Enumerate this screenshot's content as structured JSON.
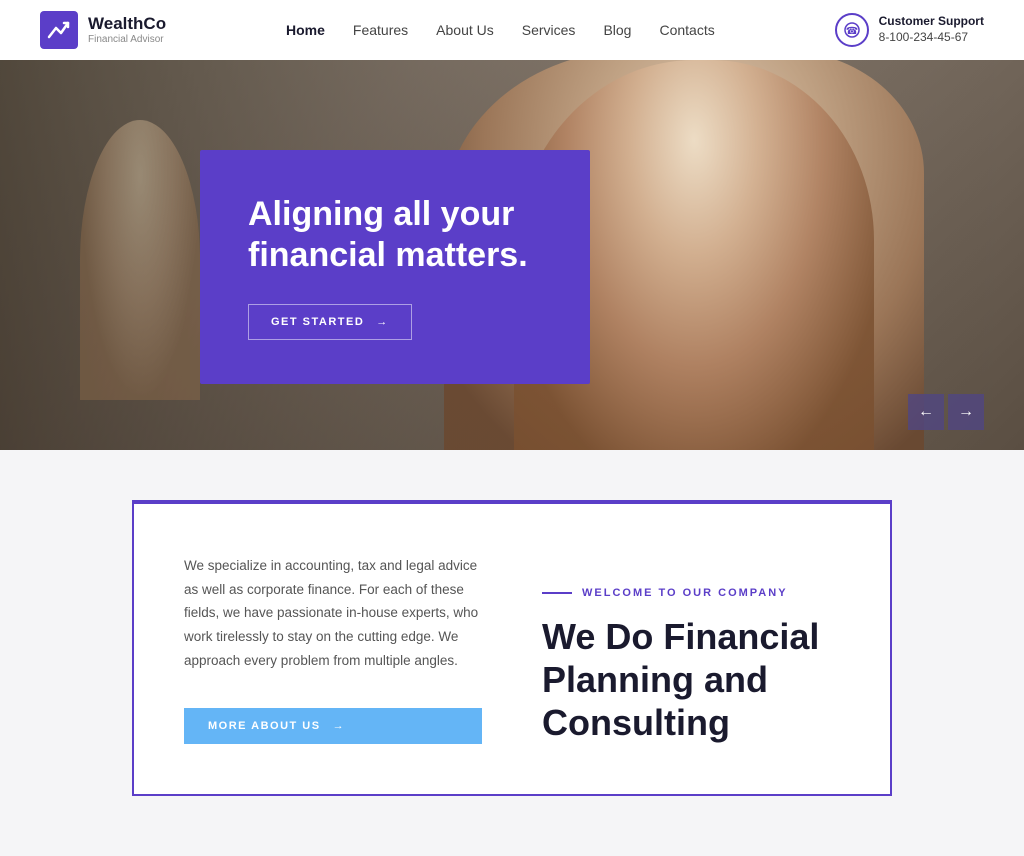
{
  "brand": {
    "name": "WealthCo",
    "subtitle": "Financial Advisor",
    "logo_icon": "chart-icon"
  },
  "nav": {
    "items": [
      {
        "label": "Home",
        "active": true
      },
      {
        "label": "Features",
        "active": false
      },
      {
        "label": "About Us",
        "active": false
      },
      {
        "label": "Services",
        "active": false
      },
      {
        "label": "Blog",
        "active": false
      },
      {
        "label": "Contacts",
        "active": false
      }
    ]
  },
  "support": {
    "label": "Customer Support",
    "phone": "8-100-234-45-67"
  },
  "hero": {
    "title": "Aligning all your financial matters.",
    "cta_label": "GET STARTED",
    "arrow_left": "←",
    "arrow_right": "→"
  },
  "about": {
    "welcome_label": "WELCOME TO OUR COMPANY",
    "description": "We specialize in accounting, tax and legal advice as well as corporate finance. For each of these fields, we have passionate in-house experts, who work tirelessly to stay on the cutting edge. We approach every problem from multiple angles.",
    "cta_label": "MORE ABOUT US",
    "title_line1": "We Do Financial",
    "title_line2": "Planning and",
    "title_line3": "Consulting"
  }
}
